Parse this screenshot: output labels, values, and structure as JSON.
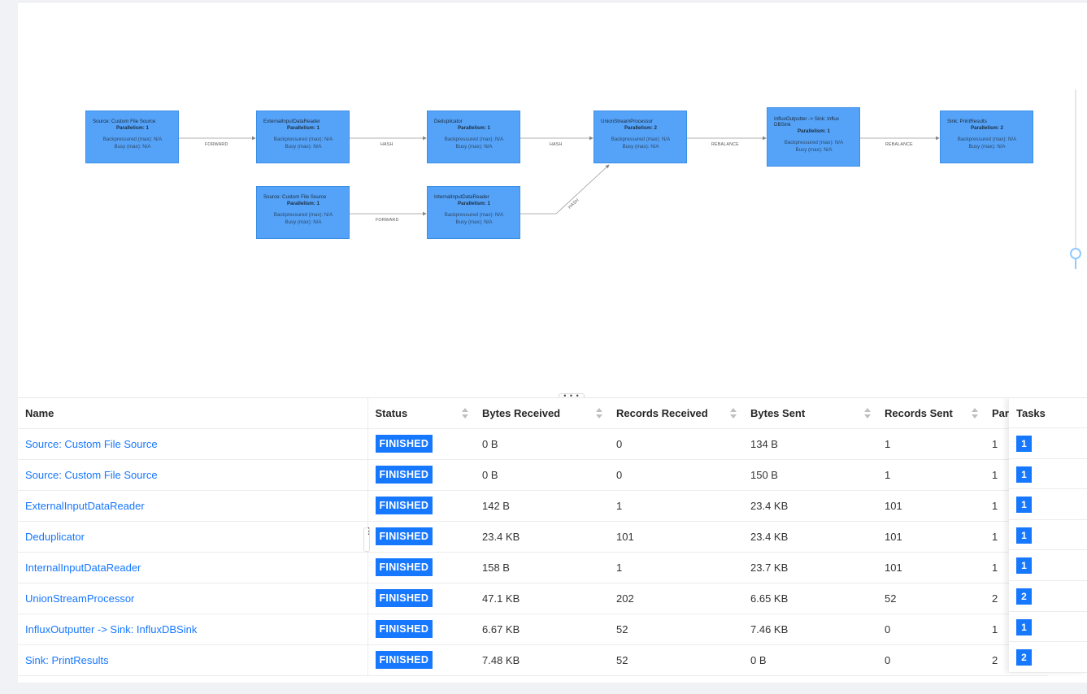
{
  "graph": {
    "nodes": [
      {
        "title": "Source: Custom File Source",
        "parallelism": "Parallelism: 1",
        "backpressured": "Backpressured (max): N/A",
        "busy": "Busy (max): N/A"
      },
      {
        "title": "ExternalInputDataReader",
        "parallelism": "Parallelism: 1",
        "backpressured": "Backpressured (max): N/A",
        "busy": "Busy (max): N/A"
      },
      {
        "title": "Deduplicator",
        "parallelism": "Parallelism: 1",
        "backpressured": "Backpressured (max): N/A",
        "busy": "Busy (max): N/A"
      },
      {
        "title": "UnionStreamProcessor",
        "parallelism": "Parallelism: 2",
        "backpressured": "Backpressured (max): N/A",
        "busy": "Busy (max): N/A"
      },
      {
        "title": "InfluxOutputter -> Sink: Influx DBSink",
        "parallelism": "Parallelism: 1",
        "backpressured": "Backpressured (max): N/A",
        "busy": "Busy (max): N/A"
      },
      {
        "title": "Sink: PrintResults",
        "parallelism": "Parallelism: 2",
        "backpressured": "Backpressured (max): N/A",
        "busy": "Busy (max): N/A"
      },
      {
        "title": "Source: Custom File Source",
        "parallelism": "Parallelism: 1",
        "backpressured": "Backpressured (max): N/A",
        "busy": "Busy (max): N/A"
      },
      {
        "title": "InternalInputDataReader",
        "parallelism": "Parallelism: 1",
        "backpressured": "Backpressured (max): N/A",
        "busy": "Busy (max): N/A"
      }
    ],
    "edges": [
      "FORWARD",
      "HASH",
      "HASH",
      "REBALANCE",
      "REBALANCE",
      "FORWARD",
      "HASH"
    ]
  },
  "divider_handle": "• • •",
  "table": {
    "headers": {
      "name": "Name",
      "status": "Status",
      "bytes_received": "Bytes Received",
      "records_received": "Records Received",
      "bytes_sent": "Bytes Sent",
      "records_sent": "Records Sent",
      "parallelism": "Parallelism",
      "tasks": "Tasks"
    },
    "rows": [
      {
        "name": "Source: Custom File Source",
        "status": "FINISHED",
        "bytes_received": "0 B",
        "records_received": "0",
        "bytes_sent": "134 B",
        "records_sent": "1",
        "parallelism": "1",
        "tasks": "1"
      },
      {
        "name": "Source: Custom File Source",
        "status": "FINISHED",
        "bytes_received": "0 B",
        "records_received": "0",
        "bytes_sent": "150 B",
        "records_sent": "1",
        "parallelism": "1",
        "tasks": "1"
      },
      {
        "name": "ExternalInputDataReader",
        "status": "FINISHED",
        "bytes_received": "142 B",
        "records_received": "1",
        "bytes_sent": "23.4 KB",
        "records_sent": "101",
        "parallelism": "1",
        "tasks": "1"
      },
      {
        "name": "Deduplicator",
        "status": "FINISHED",
        "bytes_received": "23.4 KB",
        "records_received": "101",
        "bytes_sent": "23.4 KB",
        "records_sent": "101",
        "parallelism": "1",
        "tasks": "1"
      },
      {
        "name": "InternalInputDataReader",
        "status": "FINISHED",
        "bytes_received": "158 B",
        "records_received": "1",
        "bytes_sent": "23.7 KB",
        "records_sent": "101",
        "parallelism": "1",
        "tasks": "1"
      },
      {
        "name": "UnionStreamProcessor",
        "status": "FINISHED",
        "bytes_received": "47.1 KB",
        "records_received": "202",
        "bytes_sent": "6.65 KB",
        "records_sent": "52",
        "parallelism": "2",
        "tasks": "2"
      },
      {
        "name": "InfluxOutputter -> Sink: InfluxDBSink",
        "status": "FINISHED",
        "bytes_received": "6.67 KB",
        "records_received": "52",
        "bytes_sent": "7.46 KB",
        "records_sent": "0",
        "parallelism": "1",
        "tasks": "1"
      },
      {
        "name": "Sink: PrintResults",
        "status": "FINISHED",
        "bytes_received": "7.48 KB",
        "records_received": "52",
        "bytes_sent": "0 B",
        "records_sent": "0",
        "parallelism": "2",
        "tasks": "2"
      }
    ]
  },
  "colors": {
    "node_fill": "#55a3f9",
    "accent": "#1677ff",
    "panel_bg": "#f0f2f5"
  }
}
